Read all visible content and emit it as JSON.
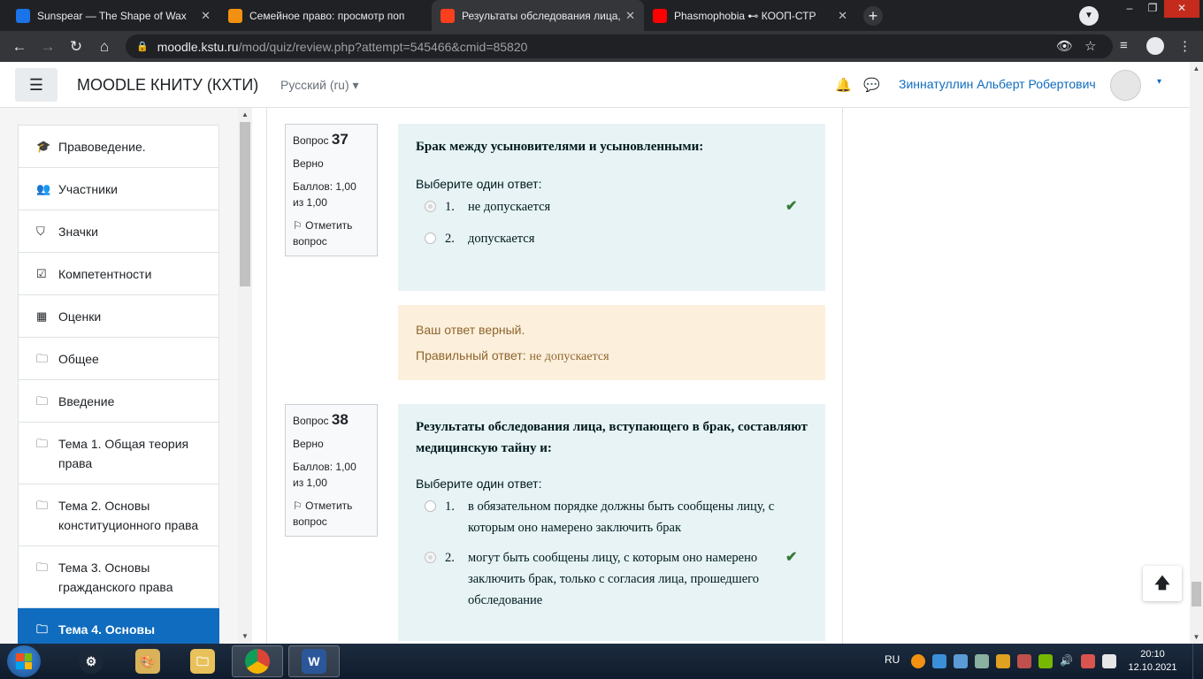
{
  "browser": {
    "tabs": [
      {
        "title": "Sunspear — The Shape of Wax",
        "favicon_color": "#1a73e8",
        "active": false
      },
      {
        "title": "Семейное право: просмотр поп",
        "favicon_color": "#f29111",
        "active": false
      },
      {
        "title": "Результаты обследования лица,",
        "favicon_color": "#fc3f1d",
        "active": true
      },
      {
        "title": "Phasmophobia ⊷ КООП-СТР",
        "favicon_color": "#ff0000",
        "active": false
      }
    ],
    "tab_close": "✕",
    "new_tab": "+",
    "address": {
      "host": "moodle.kstu.ru",
      "path": "/mod/quiz/review.php?attempt=545466&cmid=85820"
    }
  },
  "navbar": {
    "menu_icon": "☰",
    "brand": "MOODLE КНИТУ (КХТИ)",
    "language": "Русский (ru)",
    "language_caret": "▾",
    "user_name": "Зиннатуллин Альберт Робертович",
    "user_caret": "▾"
  },
  "drawer": {
    "items": [
      {
        "icon": "graduation-cap-icon",
        "glyph": "🎓",
        "label": "Правоведение."
      },
      {
        "icon": "users-icon",
        "glyph": "👥",
        "label": "Участники"
      },
      {
        "icon": "shield-icon",
        "glyph": "⛉",
        "label": "Значки"
      },
      {
        "icon": "checkbox-icon",
        "glyph": "☑",
        "label": "Компетентности"
      },
      {
        "icon": "table-icon",
        "glyph": "▦",
        "label": "Оценки"
      },
      {
        "icon": "folder-icon",
        "glyph": "🗀",
        "label": "Общее"
      },
      {
        "icon": "folder-icon",
        "glyph": "🗀",
        "label": "Введение"
      },
      {
        "icon": "folder-icon",
        "glyph": "🗀",
        "label": "Тема 1. Общая теория права"
      },
      {
        "icon": "folder-icon",
        "glyph": "🗀",
        "label": "Тема 2. Основы конституционного права"
      },
      {
        "icon": "folder-icon",
        "glyph": "🗀",
        "label": "Тема 3. Основы гражданского права"
      },
      {
        "icon": "folder-icon",
        "glyph": "🗀",
        "label": "Тема 4. Основы",
        "active": true
      }
    ]
  },
  "questions": [
    {
      "label": "Вопрос",
      "number": "37",
      "status": "Верно",
      "score": "Баллов: 1,00 из 1,00",
      "flag_label": "Отметить вопрос",
      "text": "Брак между усыновителями и усыновленными:",
      "prompt": "Выберите один ответ:",
      "answers": [
        {
          "num": "1.",
          "text": "не допускается",
          "checked": true,
          "correct": true
        },
        {
          "num": "2.",
          "text": "допускается",
          "checked": false,
          "correct": false
        }
      ],
      "feedback": {
        "result": "Ваш ответ верный.",
        "right_prefix": "Правильный ответ:",
        "right_answer": "не допускается"
      }
    },
    {
      "label": "Вопрос",
      "number": "38",
      "status": "Верно",
      "score": "Баллов: 1,00 из 1,00",
      "flag_label": "Отметить вопрос",
      "text": "Результаты обследования лица, вступающего в брак, составляют медицинскую тайну и:",
      "prompt": "Выберите один ответ:",
      "answers": [
        {
          "num": "1.",
          "text": "в обязательном порядке должны быть сообщены лицу, с которым оно намерено заключить брак",
          "checked": false,
          "correct": false
        },
        {
          "num": "2.",
          "text": "могут быть сообщены лицу, с которым оно намерено заключить брак, только с согласия лица, прошедшего обследование",
          "checked": true,
          "correct": true
        }
      ]
    }
  ],
  "back_to_top": "🡅",
  "taskbar": {
    "language": "RU",
    "time": "20:10",
    "date": "12.10.2021"
  },
  "colors": {
    "accent": "#0f6cbf",
    "question_bg": "#e7f3f5",
    "feedback_bg": "#fcefdc",
    "correct_tick": "#357a32"
  }
}
